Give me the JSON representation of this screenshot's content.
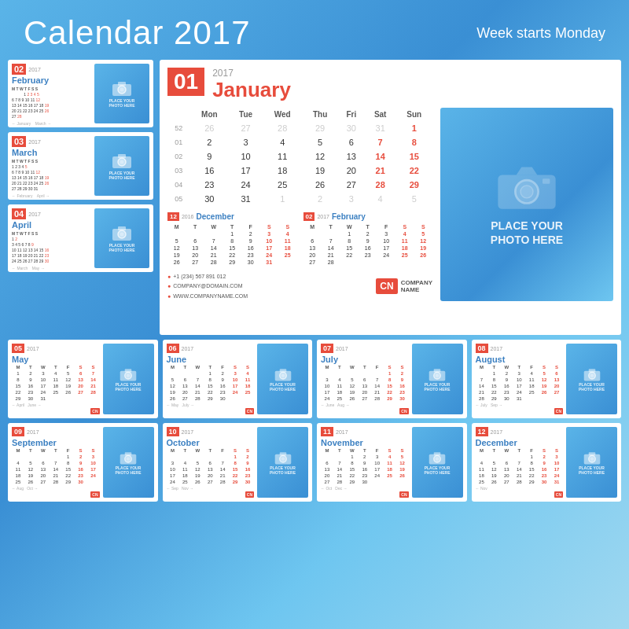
{
  "header": {
    "title": "Calendar 2017",
    "subtitle": "Week starts Monday"
  },
  "months": {
    "jan": {
      "num": "01",
      "name": "January",
      "year": "2017"
    },
    "feb": {
      "num": "02",
      "name": "February",
      "year": "2017"
    },
    "mar": {
      "num": "03",
      "name": "March",
      "year": "2017"
    },
    "apr": {
      "num": "04",
      "name": "April",
      "year": "2017"
    },
    "may": {
      "num": "05",
      "name": "May",
      "year": "2017"
    },
    "jun": {
      "num": "06",
      "name": "June",
      "year": "2017"
    },
    "jul": {
      "num": "07",
      "name": "July",
      "year": "2017"
    },
    "aug": {
      "num": "08",
      "name": "August",
      "year": "2017"
    },
    "sep": {
      "num": "09",
      "name": "September",
      "year": "2017"
    },
    "oct": {
      "num": "10",
      "name": "October",
      "year": "2017"
    },
    "nov": {
      "num": "11",
      "name": "November",
      "year": "2017"
    },
    "dec": {
      "num": "12",
      "name": "December",
      "year": "2017"
    }
  },
  "photo_placeholder": "PLACE YOUR\nPHOTO HERE",
  "contact": {
    "phone": "+1 (234) 567 891 012",
    "email": "COMPANY@DOMAIN.COM",
    "web": "WWW.COMPANYNAME.COM"
  },
  "company": {
    "abbr": "CN",
    "name": "COMPANY\nNAME"
  }
}
